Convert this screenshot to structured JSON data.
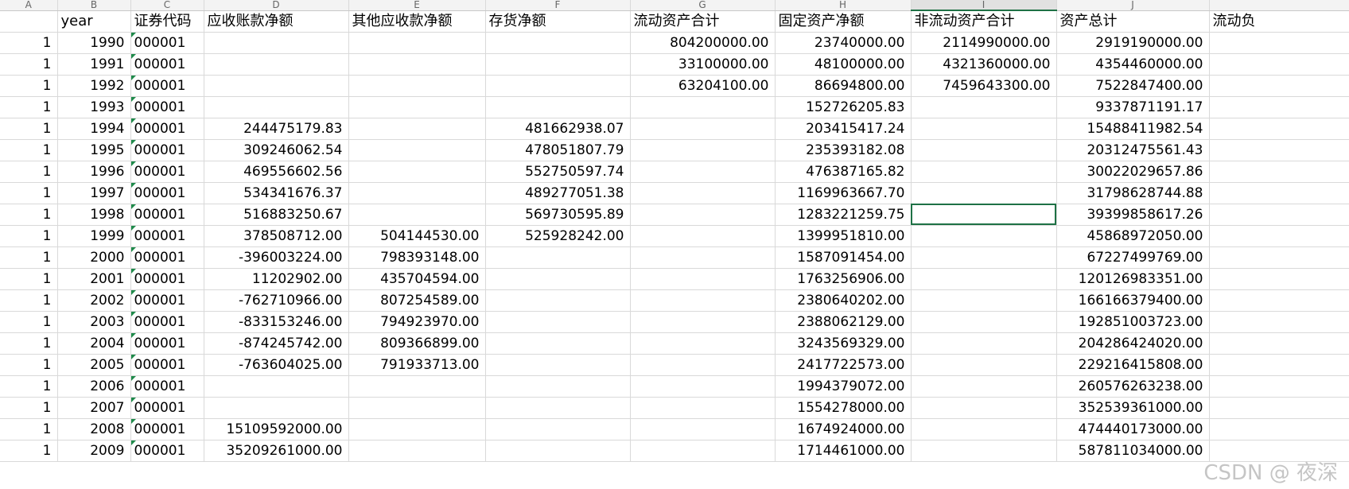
{
  "column_letters": [
    "A",
    "B",
    "C",
    "D",
    "E",
    "F",
    "G",
    "H",
    "I",
    "J",
    ""
  ],
  "headers": [
    "",
    "year",
    "证券代码",
    "应收账款净额",
    "其他应收款净额",
    "存货净额",
    "流动资产合计",
    "固定资产净额",
    "非流动资产合计",
    "资产总计",
    "流动负"
  ],
  "rows": [
    [
      "1",
      "1990",
      "000001",
      "",
      "",
      "",
      "804200000.00",
      "23740000.00",
      "2114990000.00",
      "2919190000.00",
      ""
    ],
    [
      "1",
      "1991",
      "000001",
      "",
      "",
      "",
      "33100000.00",
      "48100000.00",
      "4321360000.00",
      "4354460000.00",
      ""
    ],
    [
      "1",
      "1992",
      "000001",
      "",
      "",
      "",
      "63204100.00",
      "86694800.00",
      "7459643300.00",
      "7522847400.00",
      ""
    ],
    [
      "1",
      "1993",
      "000001",
      "",
      "",
      "",
      "",
      "152726205.83",
      "",
      "9337871191.17",
      ""
    ],
    [
      "1",
      "1994",
      "000001",
      "244475179.83",
      "",
      "481662938.07",
      "",
      "203415417.24",
      "",
      "15488411982.54",
      ""
    ],
    [
      "1",
      "1995",
      "000001",
      "309246062.54",
      "",
      "478051807.79",
      "",
      "235393182.08",
      "",
      "20312475561.43",
      ""
    ],
    [
      "1",
      "1996",
      "000001",
      "469556602.56",
      "",
      "552750597.74",
      "",
      "476387165.82",
      "",
      "30022029657.86",
      ""
    ],
    [
      "1",
      "1997",
      "000001",
      "534341676.37",
      "",
      "489277051.38",
      "",
      "1169963667.70",
      "",
      "31798628744.88",
      ""
    ],
    [
      "1",
      "1998",
      "000001",
      "516883250.67",
      "",
      "569730595.89",
      "",
      "1283221259.75",
      "",
      "39399858617.26",
      ""
    ],
    [
      "1",
      "1999",
      "000001",
      "378508712.00",
      "504144530.00",
      "525928242.00",
      "",
      "1399951810.00",
      "",
      "45868972050.00",
      ""
    ],
    [
      "1",
      "2000",
      "000001",
      "-396003224.00",
      "798393148.00",
      "",
      "",
      "1587091454.00",
      "",
      "67227499769.00",
      ""
    ],
    [
      "1",
      "2001",
      "000001",
      "11202902.00",
      "435704594.00",
      "",
      "",
      "1763256906.00",
      "",
      "120126983351.00",
      ""
    ],
    [
      "1",
      "2002",
      "000001",
      "-762710966.00",
      "807254589.00",
      "",
      "",
      "2380640202.00",
      "",
      "166166379400.00",
      ""
    ],
    [
      "1",
      "2003",
      "000001",
      "-833153246.00",
      "794923970.00",
      "",
      "",
      "2388062129.00",
      "",
      "192851003723.00",
      ""
    ],
    [
      "1",
      "2004",
      "000001",
      "-874245742.00",
      "809366899.00",
      "",
      "",
      "3243569329.00",
      "",
      "204286424020.00",
      ""
    ],
    [
      "1",
      "2005",
      "000001",
      "-763604025.00",
      "791933713.00",
      "",
      "",
      "2417722573.00",
      "",
      "229216415808.00",
      ""
    ],
    [
      "1",
      "2006",
      "000001",
      "",
      "",
      "",
      "",
      "1994379072.00",
      "",
      "260576263238.00",
      ""
    ],
    [
      "1",
      "2007",
      "000001",
      "",
      "",
      "",
      "",
      "1554278000.00",
      "",
      "352539361000.00",
      ""
    ],
    [
      "1",
      "2008",
      "000001",
      "15109592000.00",
      "",
      "",
      "",
      "1674924000.00",
      "",
      "474440173000.00",
      ""
    ],
    [
      "1",
      "2009",
      "000001",
      "35209261000.00",
      "",
      "",
      "",
      "1714461000.00",
      "",
      "587811034000.00",
      ""
    ]
  ],
  "watermark": "CSDN @ 夜深"
}
